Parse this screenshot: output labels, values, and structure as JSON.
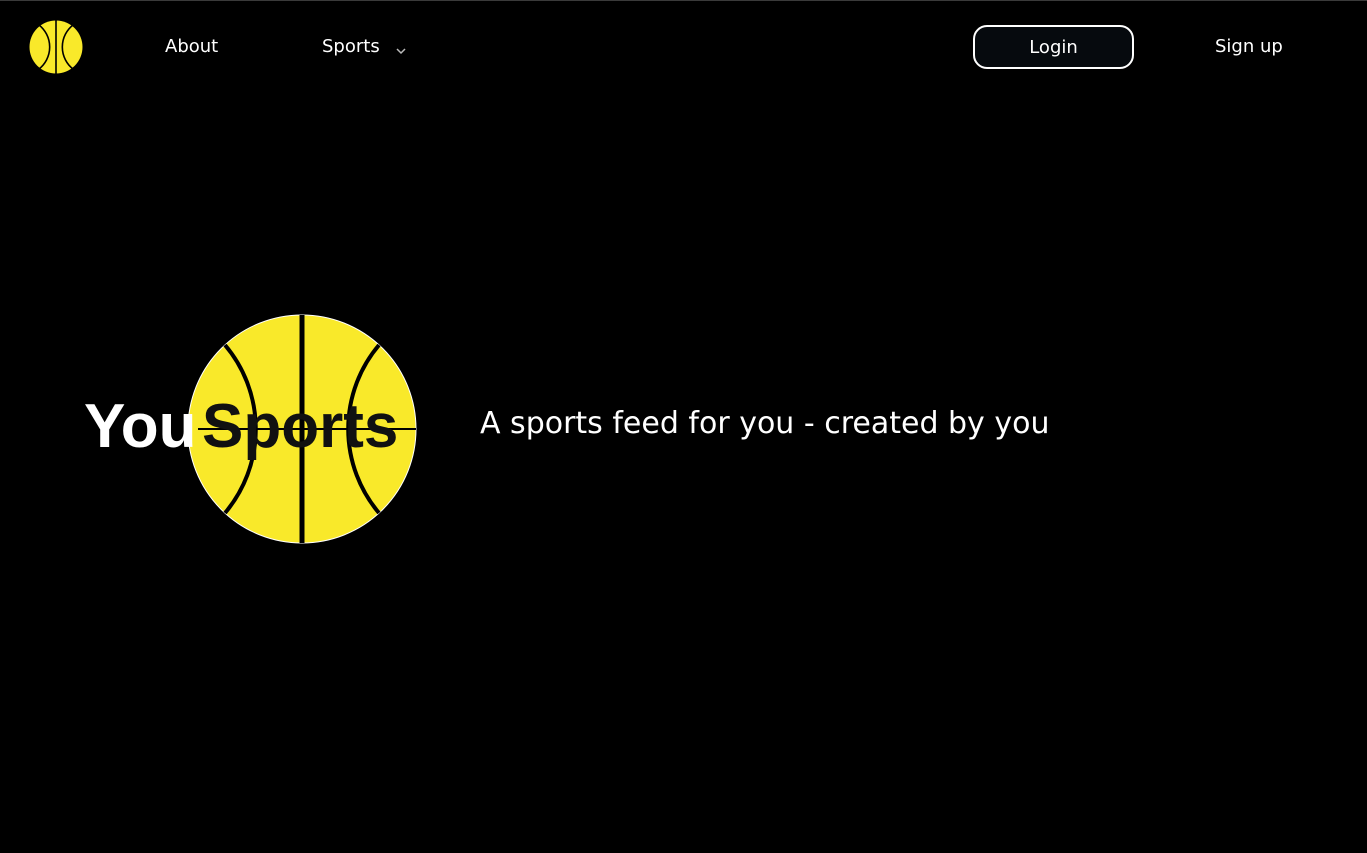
{
  "nav": {
    "logo_icon": "basketball-icon",
    "about_label": "About",
    "sports_label": "Sports",
    "sports_dropdown_icon": "chevron-down-icon",
    "login_label": "Login",
    "signup_label": "Sign up"
  },
  "hero": {
    "logo_text_you": "You",
    "logo_text_sports": "Sports",
    "logo_icon": "basketball-icon",
    "tagline": "A sports feed for you - created by you"
  },
  "colors": {
    "background": "#000000",
    "accent_yellow": "#f9e92a",
    "text": "#ffffff",
    "button_bg": "#060a0e"
  }
}
